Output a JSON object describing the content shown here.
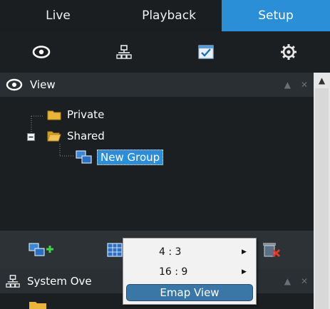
{
  "tabs": [
    {
      "label": "Live"
    },
    {
      "label": "Playback"
    },
    {
      "label": "Setup",
      "active": true
    }
  ],
  "toolbar": {
    "icons": [
      "eye-icon",
      "network-icon",
      "checklist-icon",
      "gear-icon"
    ]
  },
  "view_panel": {
    "title": "View",
    "tree": {
      "private_label": "Private",
      "shared_label": "Shared",
      "group_label": "New Group"
    }
  },
  "bottom_toolbar": {
    "icons": [
      "add-group-icon",
      "layout-grid-icon",
      "delete-group-icon"
    ]
  },
  "context_menu": {
    "items": [
      {
        "label": "4 : 3",
        "submenu": true
      },
      {
        "label": "16 : 9",
        "submenu": true
      },
      {
        "label": "Emap View",
        "selected": true
      }
    ]
  },
  "system_panel": {
    "title": "System Ove"
  },
  "colors": {
    "accent": "#2a8fd6",
    "background": "#1b1f22",
    "panel_header": "#2a2f33",
    "menu_background": "#f2f2f2",
    "menu_selected": "#3a76a6"
  }
}
